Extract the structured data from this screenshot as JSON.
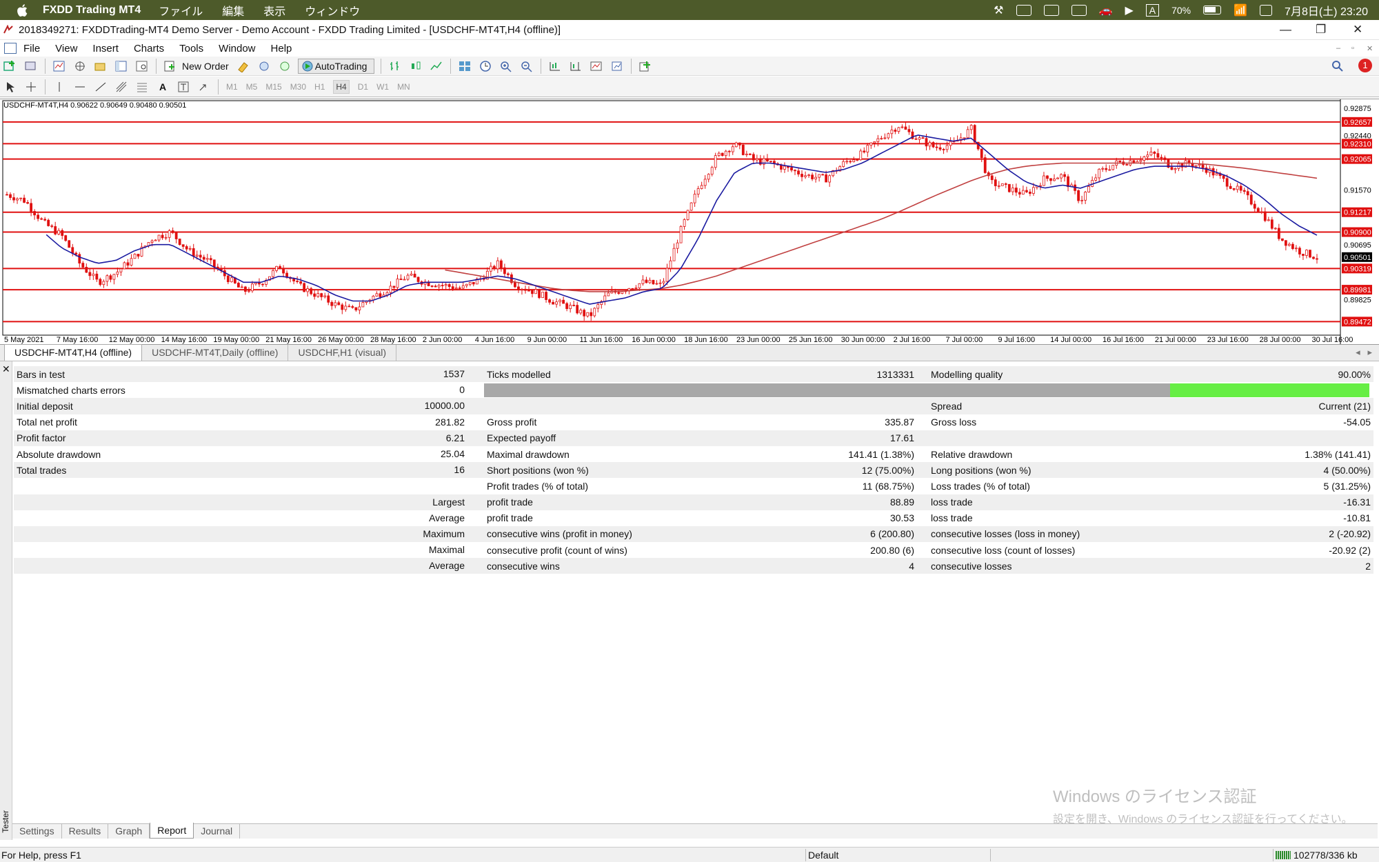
{
  "macbar": {
    "app_name": "FXDD Trading MT4",
    "menus": [
      "ファイル",
      "編集",
      "表示",
      "ウィンドウ"
    ],
    "battery": "70%",
    "input_mode": "A",
    "datetime": "7月8日(土) 23:20"
  },
  "window": {
    "title": "2018349271: FXDDTrading-MT4 Demo Server - Demo Account - FXDD Trading Limited - [USDCHF-MT4T,H4 (offline)]"
  },
  "menu": [
    "File",
    "View",
    "Insert",
    "Charts",
    "Tools",
    "Window",
    "Help"
  ],
  "toolbar": {
    "new_order": "New Order",
    "autotrading": "AutoTrading",
    "notification_count": "1",
    "timeframes": [
      "M1",
      "M5",
      "M15",
      "M30",
      "H1",
      "H4",
      "D1",
      "W1",
      "MN"
    ],
    "active_timeframe": "H4"
  },
  "chart_info": "USDCHF-MT4T,H4  0.90622 0.90649 0.90480 0.90501",
  "chart_data": {
    "type": "candlestick",
    "symbol": "USDCHF-MT4T",
    "timeframe": "H4",
    "ylim": [
      0.893,
      0.9293
    ],
    "price_ticks": [
      "0.92875",
      "0.92440",
      "0.91570",
      "0.90695",
      "0.89825"
    ],
    "current_price": "0.90501",
    "horizontal_levels": [
      "0.92657",
      "0.92310",
      "0.92065",
      "0.91217",
      "0.90900",
      "0.90319",
      "0.89981",
      "0.89472"
    ],
    "time_labels": [
      "5 May 2021",
      "7 May 16:00",
      "12 May 00:00",
      "14 May 16:00",
      "19 May 00:00",
      "21 May 16:00",
      "26 May 00:00",
      "28 May 16:00",
      "2 Jun 00:00",
      "4 Jun 16:00",
      "9 Jun 00:00",
      "11 Jun 16:00",
      "16 Jun 00:00",
      "18 Jun 16:00",
      "23 Jun 00:00",
      "25 Jun 16:00",
      "30 Jun 00:00",
      "2 Jul 16:00",
      "7 Jul 00:00",
      "9 Jul 16:00",
      "14 Jul 00:00",
      "16 Jul 16:00",
      "21 Jul 00:00",
      "23 Jul 16:00",
      "28 Jul 00:00",
      "30 Jul 16:00"
    ],
    "close_series": [
      0.915,
      0.914,
      0.9105,
      0.9085,
      0.904,
      0.901,
      0.9025,
      0.905,
      0.908,
      0.909,
      0.906,
      0.9045,
      0.902,
      0.8995,
      0.901,
      0.9035,
      0.9005,
      0.899,
      0.8975,
      0.8965,
      0.8985,
      0.9,
      0.902,
      0.901,
      0.9005,
      0.9,
      0.9015,
      0.904,
      0.9005,
      0.8995,
      0.898,
      0.897,
      0.8955,
      0.899,
      0.9,
      0.901,
      0.9005,
      0.909,
      0.916,
      0.921,
      0.923,
      0.9205,
      0.92,
      0.919,
      0.918,
      0.9175,
      0.92,
      0.9215,
      0.924,
      0.926,
      0.924,
      0.9225,
      0.923,
      0.9255,
      0.917,
      0.916,
      0.915,
      0.9175,
      0.918,
      0.914,
      0.9185,
      0.92,
      0.9205,
      0.9215,
      0.9195,
      0.92,
      0.919,
      0.917,
      0.915,
      0.912,
      0.908,
      0.906,
      0.905
    ],
    "ma_fast_series": [
      null,
      null,
      0.909,
      0.9065,
      0.905,
      0.904,
      0.9045,
      0.906,
      0.907,
      0.907,
      0.9055,
      0.904,
      0.9025,
      0.901,
      0.901,
      0.902,
      0.9015,
      0.9005,
      0.899,
      0.898,
      0.898,
      0.899,
      0.9005,
      0.901,
      0.901,
      0.901,
      0.9015,
      0.902,
      0.9015,
      0.9005,
      0.8995,
      0.8985,
      0.8975,
      0.898,
      0.8985,
      0.8995,
      0.9,
      0.903,
      0.908,
      0.914,
      0.9185,
      0.92,
      0.92,
      0.9195,
      0.919,
      0.9185,
      0.919,
      0.92,
      0.9215,
      0.923,
      0.9245,
      0.924,
      0.9235,
      0.924,
      0.9215,
      0.919,
      0.917,
      0.916,
      0.9165,
      0.916,
      0.917,
      0.918,
      0.919,
      0.9195,
      0.9195,
      0.9195,
      0.919,
      0.918,
      0.9165,
      0.9145,
      0.912,
      0.91,
      0.9085
    ],
    "ma_slow_series": [
      null,
      null,
      null,
      null,
      null,
      null,
      null,
      null,
      null,
      null,
      null,
      null,
      null,
      null,
      null,
      null,
      null,
      null,
      null,
      null,
      null,
      null,
      null,
      null,
      0.903,
      0.9025,
      0.902,
      0.9015,
      0.901,
      0.9005,
      0.9,
      0.8997,
      0.8995,
      0.8995,
      0.8996,
      0.8998,
      0.9,
      0.9005,
      0.9012,
      0.902,
      0.903,
      0.904,
      0.905,
      0.906,
      0.907,
      0.908,
      0.909,
      0.91,
      0.911,
      0.9122,
      0.9135,
      0.9148,
      0.916,
      0.9172,
      0.9182,
      0.919,
      0.9195,
      0.9198,
      0.92,
      0.92,
      0.92,
      0.92,
      0.92,
      0.92,
      0.92,
      0.92,
      0.9198,
      0.9195,
      0.9192,
      0.9188,
      0.9184,
      0.918,
      0.9176
    ]
  },
  "chart_tabs": [
    "USDCHF-MT4T,H4 (offline)",
    "USDCHF-MT4T,Daily (offline)",
    "USDCHF,H1 (visual)"
  ],
  "report": {
    "bars_in_test_label": "Bars in test",
    "bars_in_test": "1537",
    "ticks_modelled_label": "Ticks modelled",
    "ticks_modelled": "1313331",
    "modelling_quality_label": "Modelling quality",
    "modelling_quality": "90.00%",
    "modelling_quality_fraction": 0.9,
    "mismatched_label": "Mismatched charts errors",
    "mismatched": "0",
    "initial_deposit_label": "Initial deposit",
    "initial_deposit": "10000.00",
    "spread_label": "Spread",
    "spread": "Current (21)",
    "total_net_profit_label": "Total net profit",
    "total_net_profit": "281.82",
    "gross_profit_label": "Gross profit",
    "gross_profit": "335.87",
    "gross_loss_label": "Gross loss",
    "gross_loss": "-54.05",
    "profit_factor_label": "Profit factor",
    "profit_factor": "6.21",
    "expected_payoff_label": "Expected payoff",
    "expected_payoff": "17.61",
    "absolute_drawdown_label": "Absolute drawdown",
    "absolute_drawdown": "25.04",
    "maximal_drawdown_label": "Maximal drawdown",
    "maximal_drawdown": "141.41 (1.38%)",
    "relative_drawdown_label": "Relative drawdown",
    "relative_drawdown": "1.38% (141.41)",
    "total_trades_label": "Total trades",
    "total_trades": "16",
    "short_positions_label": "Short positions (won %)",
    "short_positions": "12 (75.00%)",
    "long_positions_label": "Long positions (won %)",
    "long_positions": "4 (50.00%)",
    "profit_trades_label": "Profit trades (% of total)",
    "profit_trades": "11 (68.75%)",
    "loss_trades_label": "Loss trades (% of total)",
    "loss_trades": "5 (31.25%)",
    "largest_label": "Largest",
    "largest_profit_label": "profit trade",
    "largest_profit": "88.89",
    "largest_loss_label": "loss trade",
    "largest_loss": "-16.31",
    "average_label": "Average",
    "average_profit_label": "profit trade",
    "average_profit": "30.53",
    "average_loss_label": "loss trade",
    "average_loss": "-10.81",
    "maximum_label": "Maximum",
    "max_cons_wins_label": "consecutive wins (profit in money)",
    "max_cons_wins": "6 (200.80)",
    "max_cons_losses_label": "consecutive losses (loss in money)",
    "max_cons_losses": "2 (-20.92)",
    "maximal_label": "Maximal",
    "maximal_cons_profit_label": "consecutive profit (count of wins)",
    "maximal_cons_profit": "200.80 (6)",
    "maximal_cons_loss_label": "consecutive loss (count of losses)",
    "maximal_cons_loss": "-20.92 (2)",
    "average2_label": "Average",
    "avg_cons_wins_label": "consecutive wins",
    "avg_cons_wins": "4",
    "avg_cons_losses_label": "consecutive losses",
    "avg_cons_losses": "2"
  },
  "tester_tabs": [
    "Settings",
    "Results",
    "Graph",
    "Report",
    "Journal"
  ],
  "tester_label": "Tester",
  "watermark": {
    "line1": "Windows のライセンス認証",
    "line2": "設定を開き、Windows のライセンス認証を行ってください。"
  },
  "status": {
    "help": "For Help, press F1",
    "profile": "Default",
    "traffic": "102778/336 kb"
  },
  "colors": {
    "candle": "#e01010",
    "ma_fast": "#1a1aa0",
    "ma_slow": "#c04040",
    "level_line": "#e01010",
    "quality_bar": "#66ee44"
  }
}
